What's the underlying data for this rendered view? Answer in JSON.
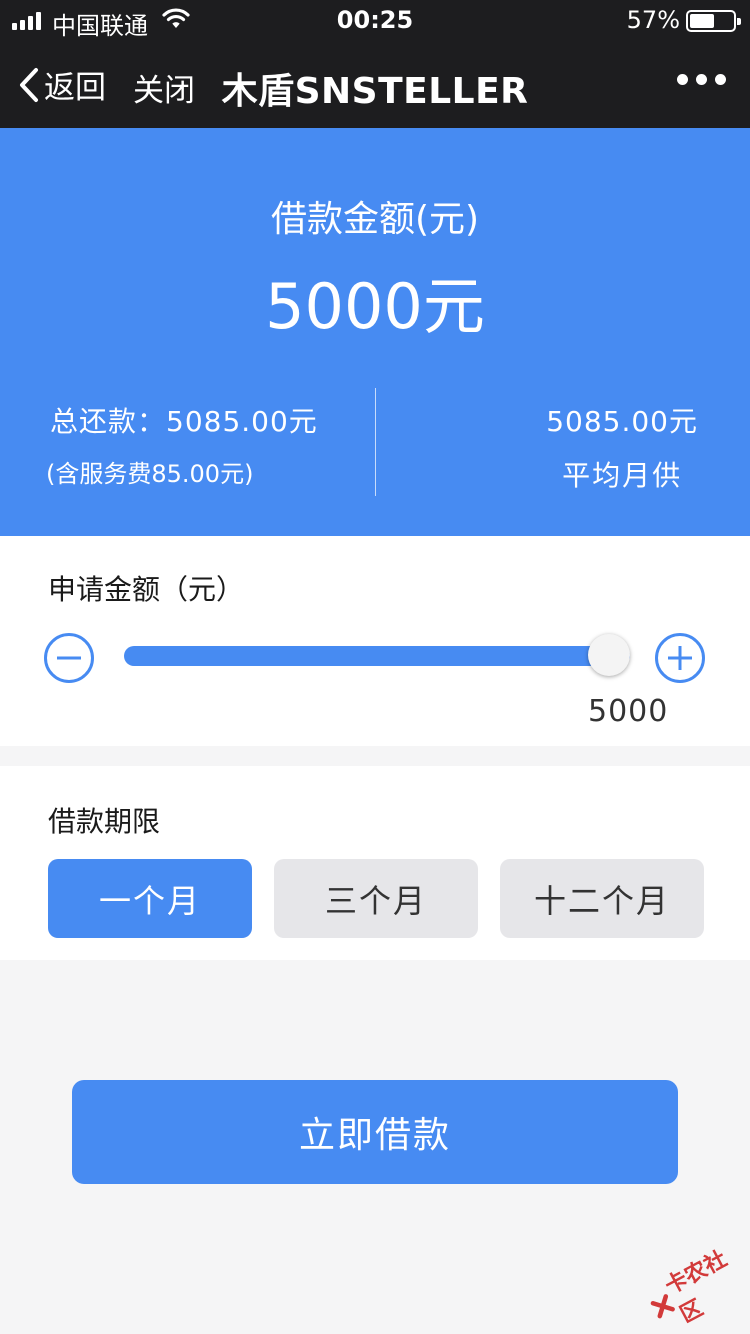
{
  "status_bar": {
    "carrier": "中国联通",
    "time": "00:25",
    "battery_percent": "57%",
    "battery_level": 0.57,
    "signal_bars": 4
  },
  "nav": {
    "back_label": "返回",
    "close_label": "关闭",
    "title": "木盾SNSTELLER",
    "more_icon": "more-dots-icon"
  },
  "summary": {
    "loan_label": "借款金额(元)",
    "loan_amount": "5000元",
    "total_repay": "总还款：5085.00元",
    "service_fee": "(含服务费85.00元)",
    "monthly_amount": "5085.00元",
    "monthly_label": "平均月供"
  },
  "apply": {
    "label": "申请金额（元）",
    "value": "5000",
    "slider_fraction": 1.0
  },
  "term": {
    "label": "借款期限",
    "options": [
      {
        "label": "一个月",
        "selected": true
      },
      {
        "label": "三个月",
        "selected": false
      },
      {
        "label": "十二个月",
        "selected": false
      }
    ]
  },
  "submit_label": "立即借款",
  "watermark_text": "卡农社区",
  "colors": {
    "accent": "#478bf2",
    "navbar": "#1d1d1f",
    "background": "#f5f5f6",
    "inactive_option": "#e6e6e9",
    "watermark": "#d23a3a"
  }
}
